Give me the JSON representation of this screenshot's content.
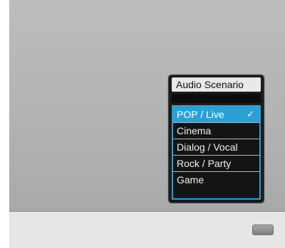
{
  "osd": {
    "title": "Audio Scenario",
    "items": [
      {
        "label": "POP / Live",
        "selected": true
      },
      {
        "label": "Cinema",
        "selected": false
      },
      {
        "label": "Dialog / Vocal",
        "selected": false
      },
      {
        "label": "Rock / Party",
        "selected": false
      },
      {
        "label": "Game",
        "selected": false
      }
    ],
    "check_glyph": "✓"
  }
}
